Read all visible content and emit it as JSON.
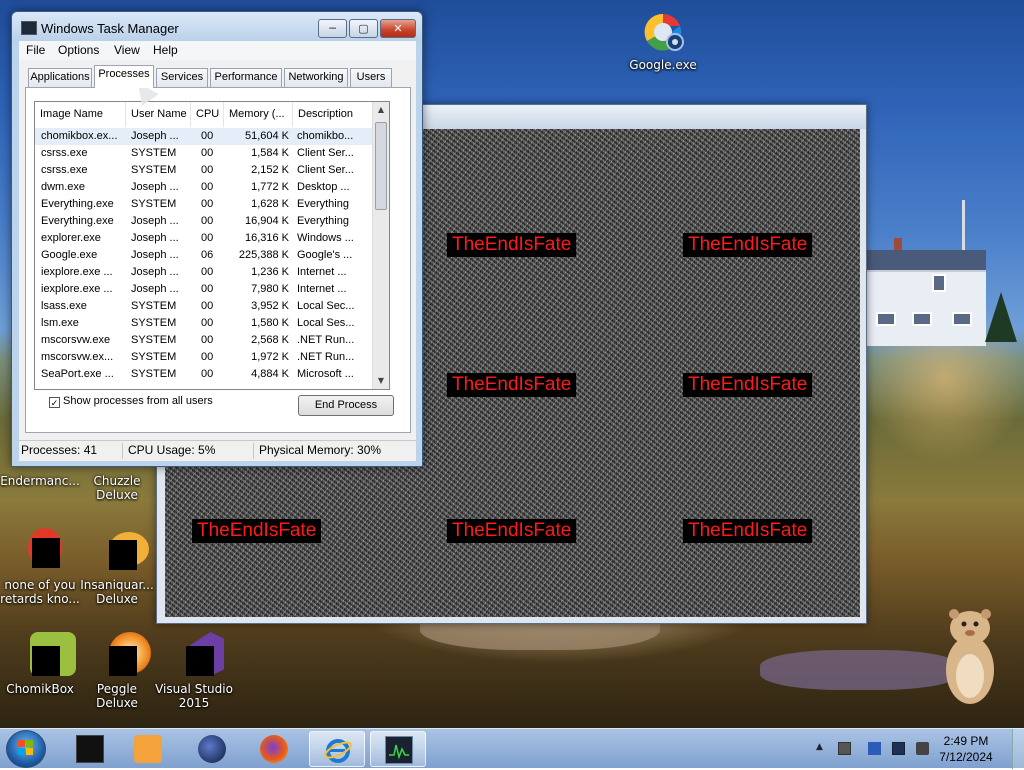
{
  "desktop": {
    "icons": [
      {
        "id": "google",
        "label": "Google.exe"
      },
      {
        "id": "enderman",
        "label": "Endermanc..."
      },
      {
        "id": "chuzzle",
        "label": "Chuzzle Deluxe"
      },
      {
        "id": "noneofyou",
        "label": "none of you retards kno..."
      },
      {
        "id": "insaniquarium",
        "label": "Insaniquar... Deluxe"
      },
      {
        "id": "chomikbox",
        "label": "ChomikBox"
      },
      {
        "id": "peggle",
        "label": "Peggle Deluxe"
      },
      {
        "id": "visualstudio",
        "label": "Visual Studio 2015"
      }
    ]
  },
  "static_window": {
    "messages": [
      "TheEndIsFate",
      "TheEndIsFate",
      "TheEndIsFate",
      "TheEndIsFate",
      "TheEndIsFate",
      "TheEndIsFate",
      "TheEndIsFate"
    ]
  },
  "task_manager": {
    "title": "Windows Task Manager",
    "menu": [
      "File",
      "Options",
      "View",
      "Help"
    ],
    "tabs": [
      "Applications",
      "Processes",
      "Services",
      "Performance",
      "Networking",
      "Users"
    ],
    "active_tab": "Processes",
    "columns": [
      "Image Name",
      "User Name",
      "CPU",
      "Memory (...",
      "Description"
    ],
    "rows": [
      {
        "name": "chomikbox.ex...",
        "user": "Joseph ...",
        "cpu": "00",
        "mem": "51,604 K",
        "desc": "chomikbo..."
      },
      {
        "name": "csrss.exe",
        "user": "SYSTEM",
        "cpu": "00",
        "mem": "1,584 K",
        "desc": "Client Ser..."
      },
      {
        "name": "csrss.exe",
        "user": "SYSTEM",
        "cpu": "00",
        "mem": "2,152 K",
        "desc": "Client Ser..."
      },
      {
        "name": "dwm.exe",
        "user": "Joseph ...",
        "cpu": "00",
        "mem": "1,772 K",
        "desc": "Desktop ..."
      },
      {
        "name": "Everything.exe",
        "user": "SYSTEM",
        "cpu": "00",
        "mem": "1,628 K",
        "desc": "Everything"
      },
      {
        "name": "Everything.exe",
        "user": "Joseph ...",
        "cpu": "00",
        "mem": "16,904 K",
        "desc": "Everything"
      },
      {
        "name": "explorer.exe",
        "user": "Joseph ...",
        "cpu": "00",
        "mem": "16,316 K",
        "desc": "Windows ..."
      },
      {
        "name": "Google.exe",
        "user": "Joseph ...",
        "cpu": "06",
        "mem": "225,388 K",
        "desc": "Google's ..."
      },
      {
        "name": "iexplore.exe ...",
        "user": "Joseph ...",
        "cpu": "00",
        "mem": "1,236 K",
        "desc": "Internet ..."
      },
      {
        "name": "iexplore.exe ...",
        "user": "Joseph ...",
        "cpu": "00",
        "mem": "7,980 K",
        "desc": "Internet ..."
      },
      {
        "name": "lsass.exe",
        "user": "SYSTEM",
        "cpu": "00",
        "mem": "3,952 K",
        "desc": "Local Sec..."
      },
      {
        "name": "lsm.exe",
        "user": "SYSTEM",
        "cpu": "00",
        "mem": "1,580 K",
        "desc": "Local Ses..."
      },
      {
        "name": "mscorsvw.exe",
        "user": "SYSTEM",
        "cpu": "00",
        "mem": "2,568 K",
        "desc": ".NET Run..."
      },
      {
        "name": "mscorsvw.ex...",
        "user": "SYSTEM",
        "cpu": "00",
        "mem": "1,972 K",
        "desc": ".NET Run..."
      },
      {
        "name": "SeaPort.exe ...",
        "user": "SYSTEM",
        "cpu": "00",
        "mem": "4,884 K",
        "desc": "Microsoft ..."
      }
    ],
    "show_all_label": "Show processes from all users",
    "show_all_checked": true,
    "end_process_label": "End Process",
    "status": {
      "processes": "Processes: 41",
      "cpu": "CPU Usage: 5%",
      "memory": "Physical Memory: 30%"
    }
  },
  "taskbar": {
    "clock_time": "2:49 PM",
    "clock_date": "7/12/2024"
  }
}
